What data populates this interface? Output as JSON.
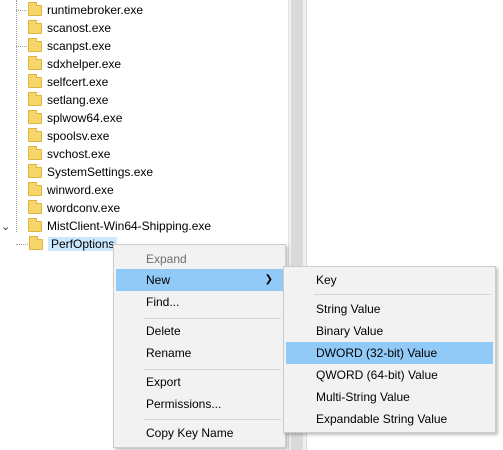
{
  "tree": {
    "items": [
      "runtimebroker.exe",
      "scanost.exe",
      "scanpst.exe",
      "sdxhelper.exe",
      "selfcert.exe",
      "setlang.exe",
      "splwow64.exe",
      "spoolsv.exe",
      "svchost.exe",
      "SystemSettings.exe",
      "winword.exe",
      "wordconv.exe",
      "MistClient-Win64-Shipping.exe"
    ],
    "selected_child": "PerfOptions"
  },
  "context_menu": {
    "expand": "Expand",
    "new": "New",
    "find": "Find...",
    "delete": "Delete",
    "rename": "Rename",
    "export": "Export",
    "permissions": "Permissions...",
    "copy_key_name": "Copy Key Name"
  },
  "submenu": {
    "key": "Key",
    "string_value": "String Value",
    "binary_value": "Binary Value",
    "dword_value": "DWORD (32-bit) Value",
    "qword_value": "QWORD (64-bit) Value",
    "multi_string_value": "Multi-String Value",
    "expandable_string_value": "Expandable String Value"
  },
  "icons": {
    "folder": "folder-icon",
    "expand": "chevron-down-icon",
    "submenu_arrow": "chevron-right-icon"
  },
  "colors": {
    "highlight": "#91c9f7",
    "selected_node": "#cce8ff",
    "folder": "#f6d66b",
    "menu_bg": "#f2f2f2"
  }
}
